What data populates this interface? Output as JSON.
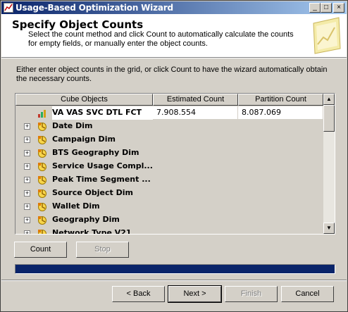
{
  "window": {
    "title": "Usage-Based Optimization Wizard",
    "controls": {
      "minimize": "_",
      "maximize": "□",
      "close": "×"
    }
  },
  "header": {
    "title": "Specify Object Counts",
    "description": "Select the count method and click Count to automatically calculate the counts for empty fields, or manually enter the object counts."
  },
  "instructions": "Either enter object counts in the grid, or click Count to have the wizard automatically obtain the necessary counts.",
  "grid": {
    "columns": [
      "Cube Objects",
      "Estimated Count",
      "Partition Count"
    ],
    "rows": [
      {
        "name": "VA VAS SVC DTL FCT",
        "icon": "measure-group-icon",
        "estimated": "7.908.554",
        "partition": "8.087.069"
      },
      {
        "name": "Date Dim",
        "icon": "dimension-icon",
        "estimated": "",
        "partition": ""
      },
      {
        "name": "Campaign Dim",
        "icon": "dimension-icon",
        "estimated": "",
        "partition": ""
      },
      {
        "name": "BTS Geography Dim",
        "icon": "dimension-icon",
        "estimated": "",
        "partition": ""
      },
      {
        "name": "Service Usage Compl...",
        "icon": "dimension-icon",
        "estimated": "",
        "partition": ""
      },
      {
        "name": "Peak Time Segment ...",
        "icon": "dimension-icon",
        "estimated": "",
        "partition": ""
      },
      {
        "name": "Source Object Dim",
        "icon": "dimension-icon",
        "estimated": "",
        "partition": ""
      },
      {
        "name": "Wallet Dim",
        "icon": "dimension-icon",
        "estimated": "",
        "partition": ""
      },
      {
        "name": "Geography Dim",
        "icon": "dimension-icon",
        "estimated": "",
        "partition": ""
      },
      {
        "name": "Network Type V21",
        "icon": "dimension-icon",
        "estimated": "",
        "partition": ""
      }
    ],
    "expander_glyph": "+"
  },
  "actions": {
    "count": "Count",
    "stop": "Stop"
  },
  "progress": {
    "value": 1.0,
    "color": "#0a246a"
  },
  "footer": {
    "back": "< Back",
    "next": "Next >",
    "finish": "Finish",
    "cancel": "Cancel"
  },
  "scrollbar": {
    "up": "▲",
    "down": "▼"
  }
}
